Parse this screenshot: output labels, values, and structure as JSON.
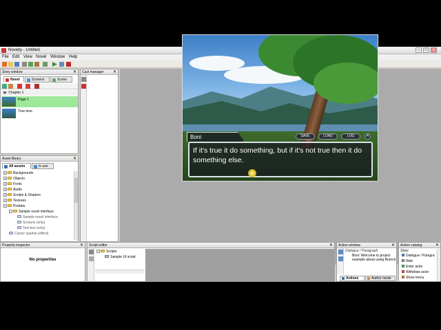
{
  "window": {
    "title": "Novelty - Untitled"
  },
  "menu": [
    "File",
    "Edit",
    "View",
    "Novel",
    "Window",
    "Help"
  ],
  "story_window": {
    "title": "Story window",
    "tabs": [
      "Novel",
      "Screens",
      "Scene"
    ],
    "chapter": "Chapter 1",
    "pages": [
      {
        "label": "Page 1"
      },
      {
        "label": "True love."
      }
    ]
  },
  "cast_manager": {
    "title": "Cast manager"
  },
  "asset_library": {
    "title": "Asset library",
    "tabs": [
      "All assets",
      "In use"
    ],
    "items": [
      "Backgrounds",
      "Objects",
      "Fonts",
      "Audio",
      "Scripts & Shaders",
      "Textures",
      "Prefabs",
      "Sample novel interface",
      "Sample novel interface",
      "Screens (only)",
      "Text box (only)",
      "Cursor sparkle (effect)"
    ]
  },
  "scene": {
    "speaker": "Boni",
    "dialogue": "If it's true it do something, but if it's not true then it do something else.",
    "buttons": [
      "SAVE",
      "LOAD",
      "LOG"
    ],
    "close": "✕"
  },
  "property_inspector": {
    "title": "Property inspector",
    "empty_text": "No properties"
  },
  "script_editor": {
    "title": "Script editor",
    "items": [
      "Scripts",
      "Sample UI script"
    ]
  },
  "action_window": {
    "title": "Action window",
    "entry_title": "Dialogue / Paragraph",
    "entry_text": "Boni: Welcome to project example about using Branch",
    "tabs": [
      "Actions",
      "Author mode"
    ]
  },
  "action_catalog": {
    "title": "Action catalog",
    "category": "Story",
    "items": [
      "Dialogue / Paragra",
      "Wait",
      "Enter actor",
      "Withdraw actor",
      "Show menu"
    ]
  },
  "colors": {
    "selection": "#9fe89a",
    "accent": "#3a6ea5"
  }
}
